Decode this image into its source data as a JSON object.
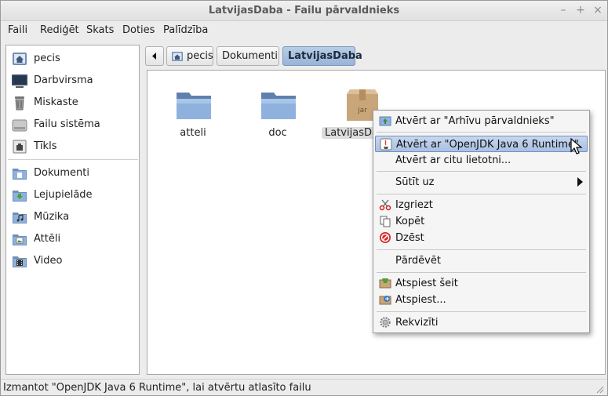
{
  "window": {
    "title": "LatvijasDaba - Failu pārvaldnieks",
    "controls": {
      "minimize": "–",
      "maximize": "+",
      "close": "×"
    }
  },
  "menubar": [
    {
      "label": "Faili"
    },
    {
      "label": "Rediģēt"
    },
    {
      "label": "Skats"
    },
    {
      "label": "Doties"
    },
    {
      "label": "Palīdzība"
    }
  ],
  "sidebar": {
    "places": [
      {
        "label": "pecis",
        "icon": "home-icon"
      },
      {
        "label": "Darbvirsma",
        "icon": "desktop-icon"
      },
      {
        "label": "Miskaste",
        "icon": "trash-icon"
      },
      {
        "label": "Failu sistēma",
        "icon": "drive-icon"
      },
      {
        "label": "Tīkls",
        "icon": "network-icon"
      }
    ],
    "bookmarks": [
      {
        "label": "Dokumenti",
        "icon": "documents-folder-icon"
      },
      {
        "label": "Lejupielāde",
        "icon": "downloads-folder-icon"
      },
      {
        "label": "Mūzika",
        "icon": "music-folder-icon"
      },
      {
        "label": "Attēli",
        "icon": "pictures-folder-icon"
      },
      {
        "label": "Video",
        "icon": "video-folder-icon"
      }
    ]
  },
  "pathbar": {
    "back_icon": "triangle-left-icon",
    "crumbs": [
      {
        "label": "pecis"
      },
      {
        "label": "Dokumenti"
      },
      {
        "label": "LatvijasDaba",
        "active": true
      }
    ]
  },
  "files": [
    {
      "name": "atteli",
      "type": "folder"
    },
    {
      "name": "doc",
      "type": "folder"
    },
    {
      "name": "LatvijasDaba",
      "type": "jar",
      "badge": "jar"
    }
  ],
  "context_menu": {
    "items": [
      {
        "label": "Atvērt ar \"Arhīvu pārvaldnieks\"",
        "icon": "archive-manager-icon"
      },
      {
        "label": "Atvērt ar \"OpenJDK Java 6 Runtime\"",
        "icon": "java-icon",
        "highlighted": true
      },
      {
        "label": "Atvērt ar citu lietotni...",
        "icon": ""
      },
      {
        "label": "Sūtīt uz",
        "icon": "",
        "submenu": true
      },
      {
        "label": "Izgriezt",
        "icon": "scissors-icon"
      },
      {
        "label": "Kopēt",
        "icon": "copy-icon"
      },
      {
        "label": "Dzēst",
        "icon": "delete-icon"
      },
      {
        "label": "Pārdēvēt",
        "icon": ""
      },
      {
        "label": "Atspiest šeit",
        "icon": "extract-here-icon"
      },
      {
        "label": "Atspiest...",
        "icon": "extract-icon"
      },
      {
        "label": "Rekvizīti",
        "icon": "gear-icon"
      }
    ]
  },
  "statusbar": {
    "text": "Izmantot \"OpenJDK Java 6 Runtime\", lai atvērtu atlasīto failu"
  },
  "colors": {
    "selection": "#a9c0e3",
    "folder": "#8fb1dd",
    "window_bg": "#ececec"
  }
}
